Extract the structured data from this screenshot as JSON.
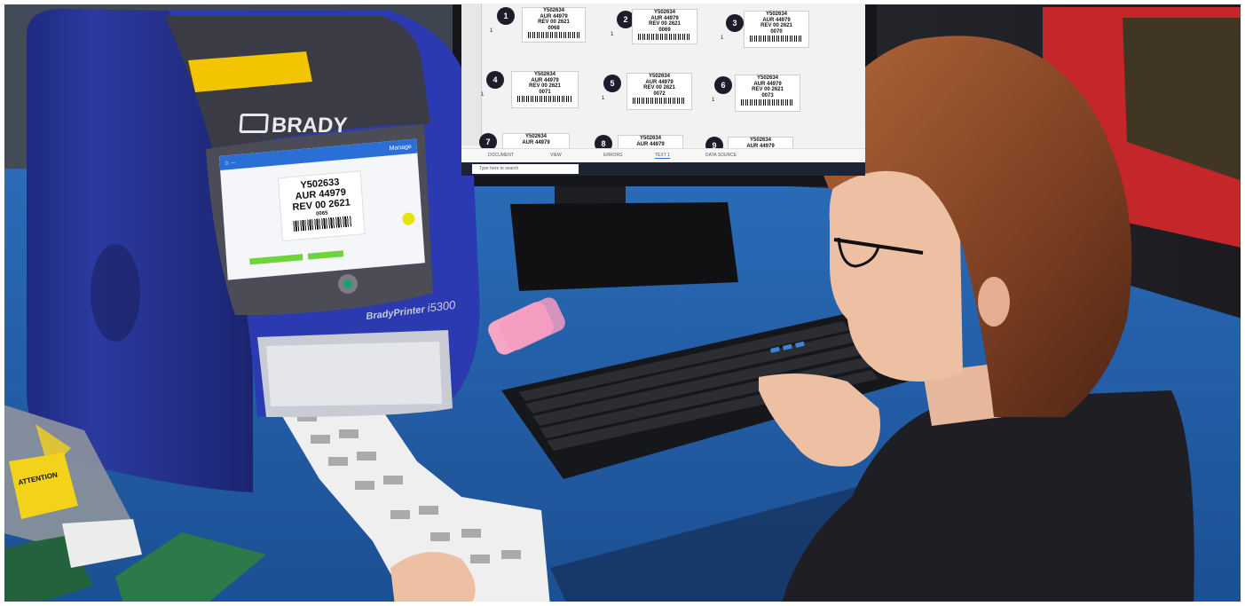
{
  "printer": {
    "brand": "BRADY",
    "model_name": "BradyPrinter",
    "model_number": "i5300",
    "screen": {
      "menu_text": "Manage",
      "label_line1": "Y502633",
      "label_line2": "AUR 44979",
      "label_line3": "REV 00 2621",
      "label_serial": "0065"
    }
  },
  "monitor": {
    "labels": [
      {
        "num": "1",
        "l1": "Y502634",
        "l2": "AUR 44979",
        "l3": "REV 00 2621",
        "serial": "0068",
        "qty": "1"
      },
      {
        "num": "2",
        "l1": "Y502634",
        "l2": "AUR 44979",
        "l3": "REV 00 2621",
        "serial": "0069",
        "qty": "1"
      },
      {
        "num": "3",
        "l1": "Y502634",
        "l2": "AUR 44979",
        "l3": "REV 00 2621",
        "serial": "0070",
        "qty": "1"
      },
      {
        "num": "4",
        "l1": "Y502634",
        "l2": "AUR 44979",
        "l3": "REV 00 2621",
        "serial": "0071",
        "qty": "1"
      },
      {
        "num": "5",
        "l1": "Y502634",
        "l2": "AUR 44979",
        "l3": "REV 00 2621",
        "serial": "0072",
        "qty": "1"
      },
      {
        "num": "6",
        "l1": "Y502634",
        "l2": "AUR 44979",
        "l3": "REV 00 2621",
        "serial": "0073",
        "qty": "1"
      },
      {
        "num": "7",
        "l1": "Y502634",
        "l2": "AUR 44979"
      },
      {
        "num": "8",
        "l1": "Y502634",
        "l2": "AUR 44979"
      },
      {
        "num": "9",
        "l1": "Y502634",
        "l2": "AUR 44979"
      }
    ],
    "tabs": [
      "DOCUMENT",
      "VIEW",
      "ERRORS",
      "TEXT 1",
      "DATA SOURCE"
    ],
    "taskbar_search": "Type here to search"
  },
  "warning_bag": {
    "text": "ATTENTION"
  },
  "colors": {
    "printer_blue": "#27338f",
    "printer_top": "#3a3b44",
    "lid_yellow": "#f3c400",
    "desk_blue": "#1f5ea8",
    "backdrop": "#2b2c33",
    "hair": "#8a4a2a"
  }
}
